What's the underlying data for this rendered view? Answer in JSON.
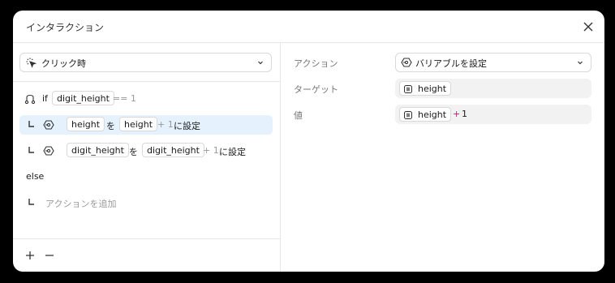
{
  "dialog": {
    "title": "インタラクション"
  },
  "trigger": {
    "label": "クリック時"
  },
  "logic": {
    "if_keyword": "if",
    "condition_var": "digit_height",
    "condition_op": "== 1",
    "action1": {
      "target": "height",
      "wo": "を",
      "source": "height",
      "op": "+ 1",
      "suffix": "に設定"
    },
    "action2": {
      "target": "digit_height",
      "wo": "を",
      "source": "digit_height",
      "op": "+ 1",
      "suffix": "に設定"
    },
    "else_keyword": "else",
    "add_action_placeholder": "アクションを追加"
  },
  "properties": {
    "action_label": "アクション",
    "action_value": "バリアブルを設定",
    "target_label": "ターゲット",
    "target_value": "height",
    "value_label": "値",
    "value_var": "height",
    "value_plus": "+",
    "value_number": "1"
  },
  "colors": {
    "selected_row": "#e5f1fc",
    "plus_operator": "#c2187a"
  }
}
